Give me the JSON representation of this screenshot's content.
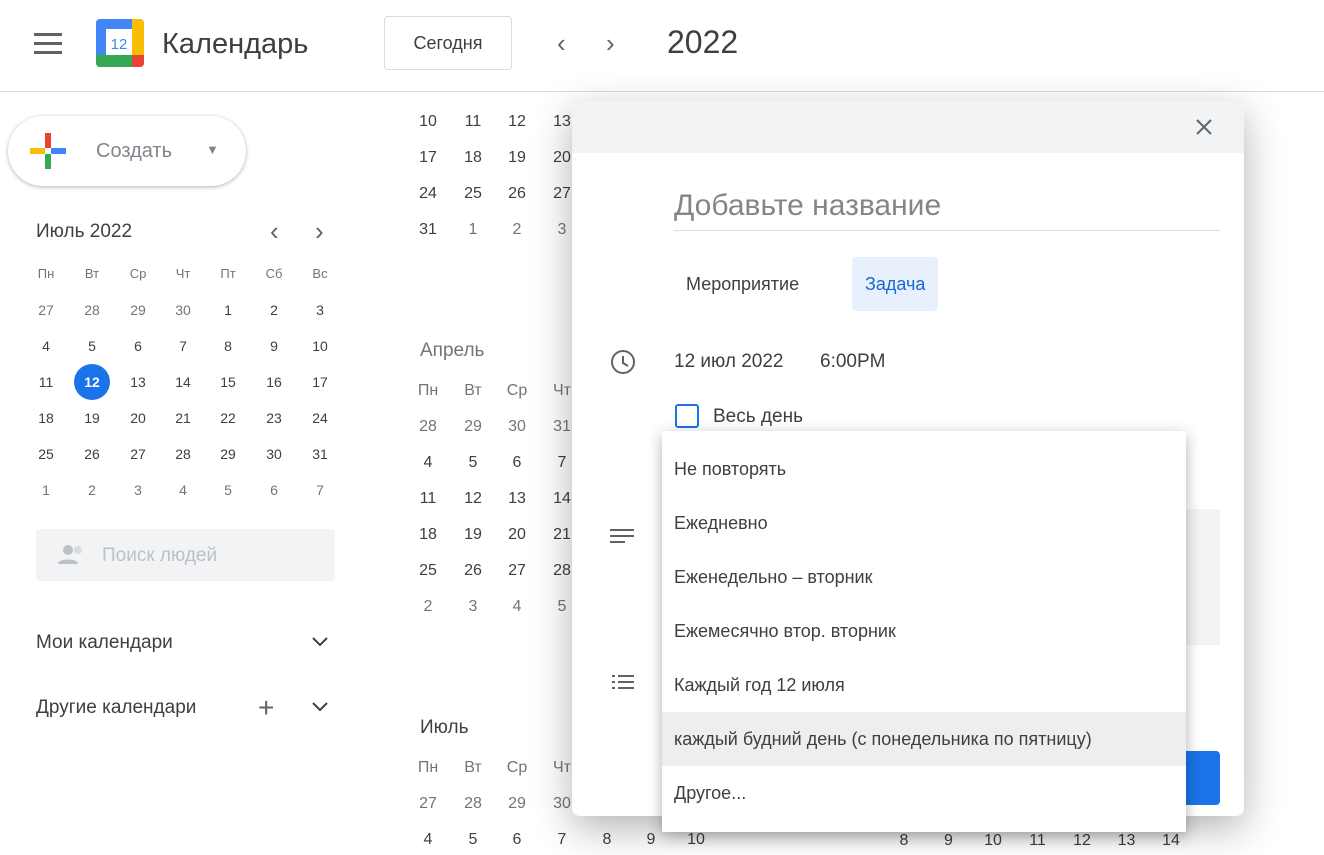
{
  "header": {
    "app_title": "Календарь",
    "logo_day": "12",
    "today_label": "Сегодня",
    "year": "2022"
  },
  "sidebar": {
    "create_label": "Создать",
    "mini": {
      "title": "Июль 2022",
      "weekdays": [
        "Пн",
        "Вт",
        "Ср",
        "Чт",
        "Пт",
        "Сб",
        "Вс"
      ],
      "weeks": [
        [
          "27",
          "28",
          "29",
          "30",
          "1",
          "2",
          "3"
        ],
        [
          "4",
          "5",
          "6",
          "7",
          "8",
          "9",
          "10"
        ],
        [
          "11",
          "12",
          "13",
          "14",
          "15",
          "16",
          "17"
        ],
        [
          "18",
          "19",
          "20",
          "21",
          "22",
          "23",
          "24"
        ],
        [
          "25",
          "26",
          "27",
          "28",
          "29",
          "30",
          "31"
        ],
        [
          "1",
          "2",
          "3",
          "4",
          "5",
          "6",
          "7"
        ]
      ],
      "today": "12"
    },
    "people_placeholder": "Поиск людей",
    "my_calendars": "Мои календари",
    "other_calendars": "Другие календари"
  },
  "year_view": {
    "march_rows": [
      [
        "10",
        "11",
        "12",
        "13"
      ],
      [
        "17",
        "18",
        "19",
        "20"
      ],
      [
        "24",
        "25",
        "26",
        "27"
      ],
      [
        "31",
        "1",
        "2",
        "3"
      ]
    ],
    "april": {
      "name": "Апрель",
      "weekdays": [
        "Пн",
        "Вт",
        "Ср",
        "Чт"
      ],
      "rows": [
        [
          "28",
          "29",
          "30",
          "31"
        ],
        [
          "4",
          "5",
          "6",
          "7"
        ],
        [
          "11",
          "12",
          "13",
          "14"
        ],
        [
          "18",
          "19",
          "20",
          "21"
        ],
        [
          "25",
          "26",
          "27",
          "28"
        ],
        [
          "2",
          "3",
          "4",
          "5"
        ]
      ]
    },
    "july": {
      "name": "Июль",
      "weekdays": [
        "Пн",
        "Вт",
        "Ср",
        "Чт"
      ],
      "rows": [
        [
          "27",
          "28",
          "29",
          "30"
        ],
        [
          "4",
          "5",
          "6",
          "7",
          "8",
          "9",
          "10"
        ]
      ]
    },
    "right_row": [
      "8",
      "9",
      "10",
      "11",
      "12",
      "13",
      "14"
    ]
  },
  "dialog": {
    "title_placeholder": "Добавьте название",
    "tab_event": "Мероприятие",
    "tab_task": "Задача",
    "date": "12 июл 2022",
    "time": "6:00PM",
    "all_day": "Весь день",
    "repeat_options": [
      "Не повторять",
      "Ежедневно",
      "Еженедельно – вторник",
      "Ежемесячно втор. вторник",
      "Каждый год 12 июля",
      "каждый будний день (с понедельника по пятницу)",
      "Другое..."
    ],
    "accent": "#1a73e8"
  }
}
